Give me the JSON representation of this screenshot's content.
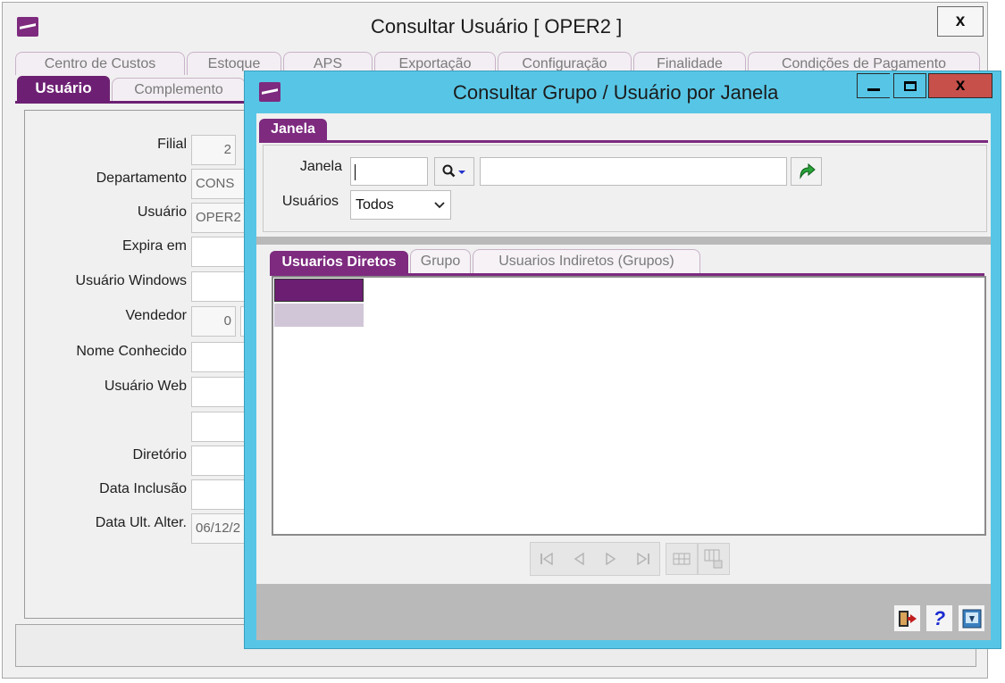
{
  "background_window": {
    "title": "Consultar Usuário [ OPER2 ]",
    "close_label": "x",
    "top_tabs": [
      "Centro de Custos",
      "Estoque",
      "APS",
      "Exportação",
      "Configuração",
      "Finalidade",
      "Condições de Pagamento"
    ],
    "sub_tabs": {
      "active": "Usuário",
      "other": "Complemento"
    },
    "fields": [
      {
        "label": "Filial",
        "value": "2"
      },
      {
        "label": "Departamento",
        "value": "CONS"
      },
      {
        "label": "Usuário",
        "value": "OPER2"
      },
      {
        "label": "Expira em",
        "value": ""
      },
      {
        "label": "Usuário Windows",
        "value": ""
      },
      {
        "label": "Vendedor",
        "value": "0"
      },
      {
        "label": "Nome Conhecido",
        "value": ""
      },
      {
        "label": "Usuário Web",
        "value": ""
      },
      {
        "label": "",
        "value": ""
      },
      {
        "label": "Diretório",
        "value": ""
      },
      {
        "label": "Data Inclusão",
        "value": ""
      },
      {
        "label": "Data Ult. Alter.",
        "value": "06/12/2"
      }
    ]
  },
  "dialog": {
    "title": "Consultar Grupo / Usuário por Janela",
    "buttons": {
      "minimize": "—",
      "maximize": "□",
      "close": "x"
    },
    "section_tab": "Janela",
    "janela_label": "Janela",
    "janela_value": "",
    "janela_description": "",
    "usuarios_label": "Usuários",
    "usuarios_selected": "Todos",
    "tabs": {
      "active": "Usuarios Diretos",
      "grupo": "Grupo",
      "indiretos": "Usuarios Indiretos (Grupos)"
    },
    "grid_rows": [],
    "colors": {
      "accent": "#7d2a7f",
      "title_bar": "#57c6e6",
      "close_button": "#c7504a"
    }
  }
}
